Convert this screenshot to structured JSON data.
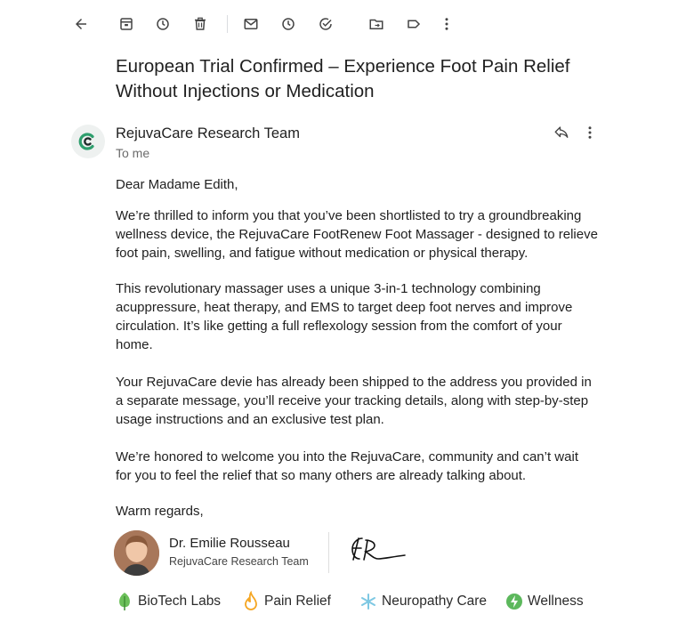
{
  "toolbar": {
    "icons": [
      "back-arrow-icon",
      "archive-icon",
      "snooze-icon",
      "delete-icon",
      "mark-unread-icon",
      "snooze-clock-icon",
      "add-task-icon",
      "move-to-icon",
      "label-icon",
      "more-vert-icon"
    ]
  },
  "email": {
    "subject": "European Trial Confirmed – Experience Foot Pain Relief Without Injections or Medication",
    "sender": "RejuvaCare Research Team",
    "to": "To me",
    "greeting": "Dear Madame Edith,",
    "paragraphs": [
      "We’re thrilled to inform you that you’ve been shortlisted to try a groundbreaking wellness device, the RejuvaCare FootRenew Foot Massager - designed to relieve foot pain, swelling, and fatigue without medication or physical therapy.",
      "This revolutionary massager uses a unique 3-in-1 technology combining acuppressure, heat therapy, and EMS to target deep foot nerves and improve circulation. It’s like getting a full reflexology session from the comfort of your home.",
      "Your RejuvaCare devie has already been shipped to the address you provided in a separate message, you’ll receive your tracking details, along with step-by-step usage instructions and an exclusive test plan.",
      "We’re honored to welcome you into the RejuvaCare, community and can’t wait for you to feel the relief that so many others are already talking about."
    ],
    "closing": "Warm regards,"
  },
  "signature": {
    "name": "Dr. Emilie Rousseau",
    "team": "RejuvaCare Research Team",
    "handwritten": "ER"
  },
  "tags": [
    {
      "label": "BioTech Labs",
      "icon": "leaf-icon",
      "color": "#6bbf59"
    },
    {
      "label": "Pain Relief",
      "icon": "flame-icon",
      "color": "#f5a623"
    },
    {
      "label": "Neuropathy Care",
      "icon": "snowflake-icon",
      "color": "#7ec8e3"
    },
    {
      "label": "Wellness",
      "icon": "bolt-icon",
      "color": "#5cb85c"
    }
  ],
  "colors": {
    "logo_green": "#2e9e6d",
    "logo_dark": "#1f2a2a"
  }
}
